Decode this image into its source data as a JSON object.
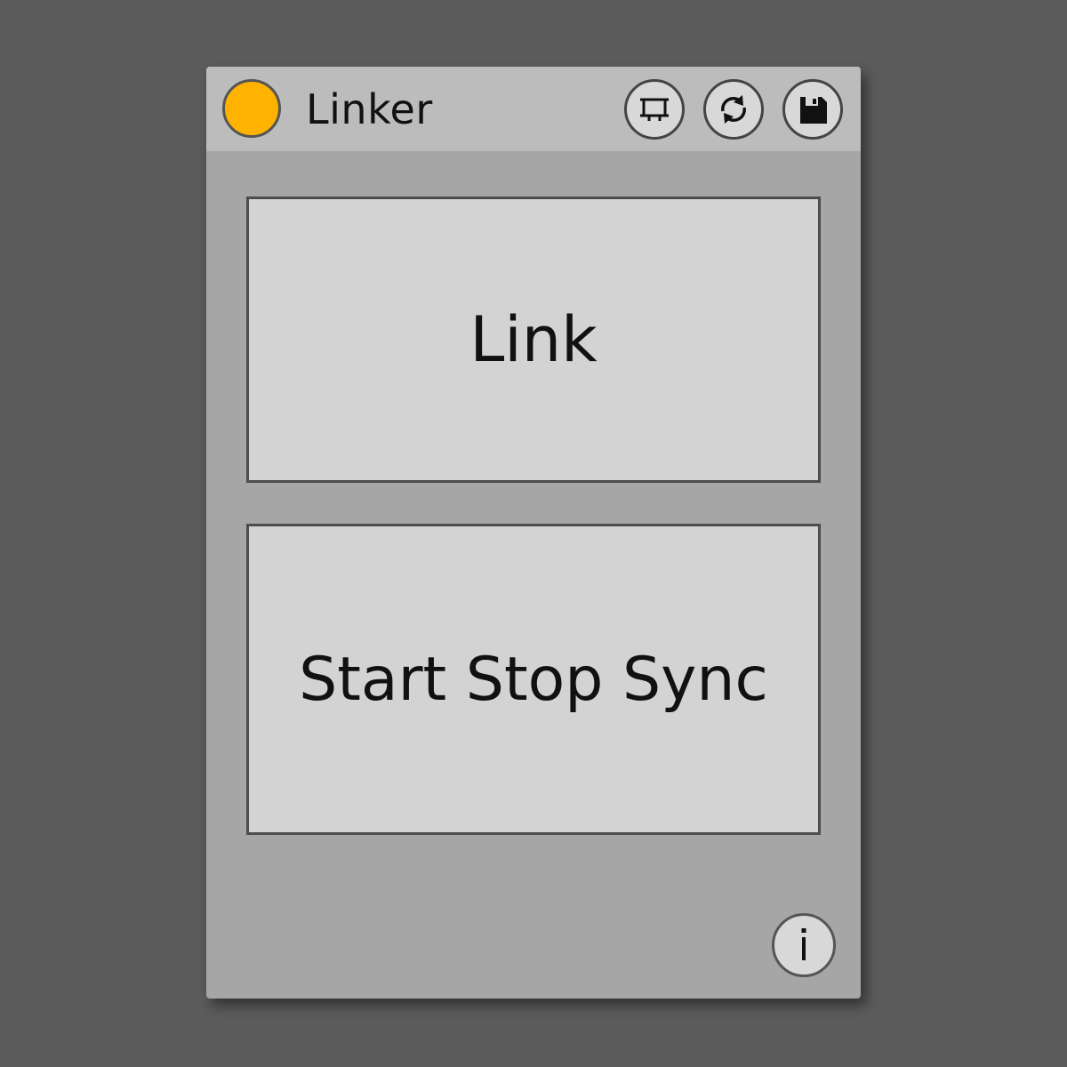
{
  "device": {
    "title": "Linker",
    "power_color": "#ffb300",
    "header_buttons": [
      {
        "icon": "frame-icon"
      },
      {
        "icon": "refresh-icon"
      },
      {
        "icon": "save-icon"
      }
    ]
  },
  "main": {
    "link_label": "Link",
    "sync_label": "Start Stop Sync"
  },
  "footer": {
    "info_icon": "info-icon",
    "info_glyph": "i"
  }
}
